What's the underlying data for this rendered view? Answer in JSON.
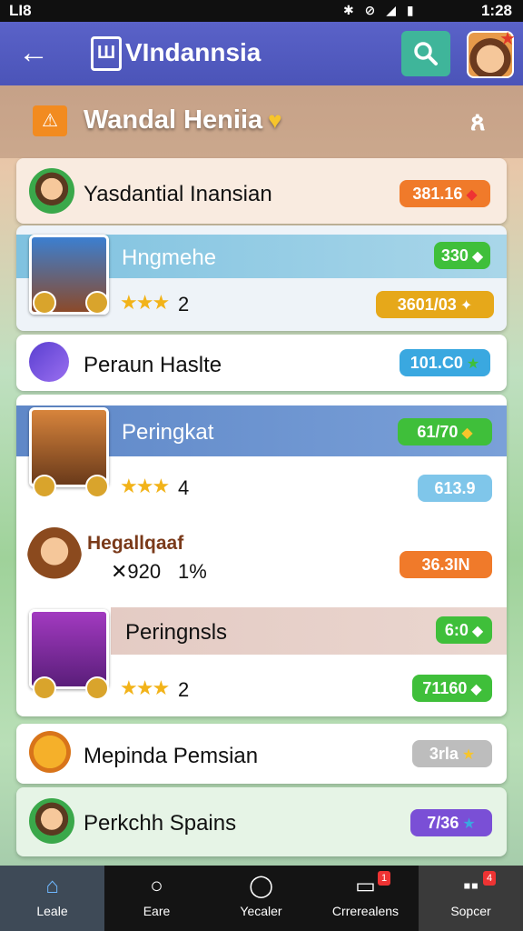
{
  "status_bar": {
    "left": "LI8",
    "right": "1:28",
    "icons": "✱ ⊘ ◢ ▮"
  },
  "app_bar": {
    "title": "VIndannsia",
    "logo_glyph": "Ш",
    "back_glyph": "←"
  },
  "subheader": {
    "title": "Wandal Heniia",
    "icon_glyph": "⚠",
    "heart_glyph": "♥",
    "user_glyph": "ጰ"
  },
  "rows": [
    {
      "label": "Yasdantial Inansian",
      "badge": "381.16",
      "badge_color": "#f07a2a"
    },
    {
      "label": "Hngmehe",
      "badge": "330",
      "badge_color": "#3fbf3a",
      "stars": "★★★",
      "count": "2",
      "sub_badge": "3601/03",
      "sub_badge_color": "#e6a81a"
    },
    {
      "label": "Peraun Haslte",
      "badge": "101.C0",
      "badge_color": "#3aa8e0"
    },
    {
      "label": "Peringkat",
      "badge": "61/70",
      "badge_color": "#3fbf3a",
      "stars": "★★★",
      "count": "4",
      "sub_badge": "613.9",
      "sub_badge_color": "#7fc6ea"
    },
    {
      "label": "Hegallqaaf",
      "sub_text": "✕920",
      "percent": "1%",
      "badge": "36.3IN",
      "badge_color": "#f07a2a"
    },
    {
      "label": "Peringnsls",
      "badge": "6:0",
      "badge_color": "#3fbf3a",
      "stars": "★★★",
      "count": "2",
      "sub_badge": "71160",
      "sub_badge_color": "#3fbf3a"
    },
    {
      "label": "Mepinda Pemsian",
      "badge": "3rla",
      "badge_color": "#bdbdbd"
    },
    {
      "label": "Perkchh Spains",
      "badge": "7/36",
      "badge_color": "#7a4fd6"
    }
  ],
  "nav": [
    {
      "label": "Leale",
      "icon": "home-icon"
    },
    {
      "label": "Eare",
      "icon": "search-icon"
    },
    {
      "label": "Yecaler",
      "icon": "chat-icon"
    },
    {
      "label": "Crrerealens",
      "icon": "message-icon",
      "badge": "1"
    },
    {
      "label": "Sopcer",
      "icon": "controller-icon",
      "badge": "4"
    }
  ]
}
